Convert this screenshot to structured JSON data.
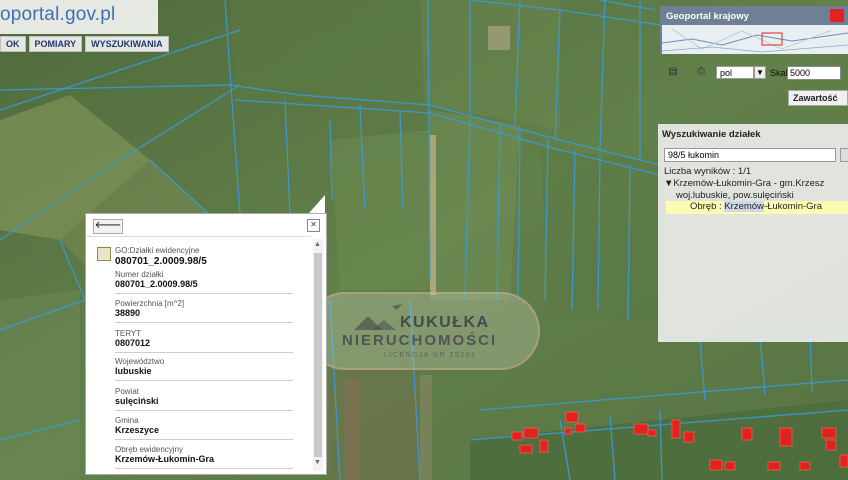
{
  "header": {
    "logo_text": "oportal.gov.pl",
    "toolbar": [
      "OK",
      "POMIARY",
      "WYSZUKIWANIA"
    ]
  },
  "minimap": {
    "title": "Geoportal krajowy"
  },
  "controls": {
    "language_value": "pol",
    "scale_label": "Skala:",
    "scale_value": "5000",
    "contents_button": "Zawartość"
  },
  "search_panel": {
    "title": "Wyszukiwanie działek",
    "query": "98/5 łukomin",
    "results_count": "Liczba wyników : 1/1",
    "result_line1": "▼Krzemów-Łukomin-Gra - gm.Krzesz",
    "result_line2": "woj.lubuskie, pow.sulęciński",
    "result_line3_prefix": "Obręb : ",
    "result_line3_highlight": "Krzemów",
    "result_line3_suffix": "-Łukomin-Gra"
  },
  "popup": {
    "back_icon": "back-arrow-icon",
    "close_icon": "close-icon",
    "layer_label": "GO:Działki ewidencyjne",
    "layer_value": "080701_2.0009.98/5",
    "fields": [
      {
        "label": "Numer działki",
        "value": "080701_2.0009.98/5"
      },
      {
        "label": "Powierzchnia [m^2]",
        "value": "38890"
      },
      {
        "label": "TERYT",
        "value": "0807012"
      },
      {
        "label": "Województwo",
        "value": "lubuskie"
      },
      {
        "label": "Powiat",
        "value": "sulęciński"
      },
      {
        "label": "Gmina",
        "value": "Krzeszyce"
      },
      {
        "label": "Obręb ewidencyjny",
        "value": "Krzemów-Łukomin-Gra"
      }
    ]
  },
  "watermark": {
    "line1": "KUKUŁKA",
    "line2": "NIERUCHOMOŚCI",
    "line3": "LICENCJA NR 25201"
  },
  "colors": {
    "parcel_line": "#3a9bd9",
    "building": "#e0231f",
    "panel_bg": "#ebebeb",
    "header_blue": "#6e7f96"
  }
}
